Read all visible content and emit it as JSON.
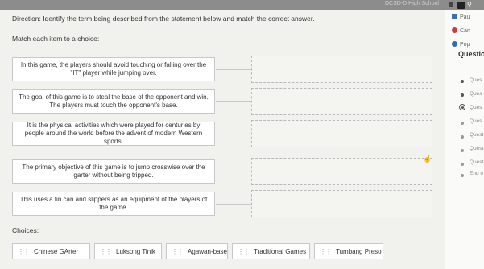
{
  "topbar": {
    "title": "DCSD-D High School"
  },
  "direction": "Direction: Identify the term being described from the statement below and match the correct answer.",
  "match_label": "Match each item to a choice:",
  "statements": [
    "In this game, the players should avoid touching or falling over the \"IT\" player while jumping over.",
    "The goal of this game is to steal the base of the opponent and win. The players must touch the opponent's base.",
    "It is the physical activities which were played for centuries by people around the world before the advent of modern Western sports.",
    "The primary objective of this game is to jump crosswise over the garter without being tripped.",
    "This uses a tin can and slippers as an equipment of the players of the game."
  ],
  "choices_label": "Choices:",
  "choices": [
    "Chinese GArter",
    "Luksong Tinik",
    "Agawan-base",
    "Traditional Games",
    "Tumbang Preso"
  ],
  "panel": {
    "controls": [
      "Pau",
      "Can",
      "Pop"
    ],
    "title": "Questio",
    "questions": [
      "Ques",
      "Ques",
      "Ques",
      "Ques",
      "Quest",
      "Quest",
      "Quest",
      "End o"
    ]
  },
  "colors": {
    "pause": "#3b6fb6",
    "cancel": "#d23a3a",
    "pop": "#2f6db5"
  }
}
